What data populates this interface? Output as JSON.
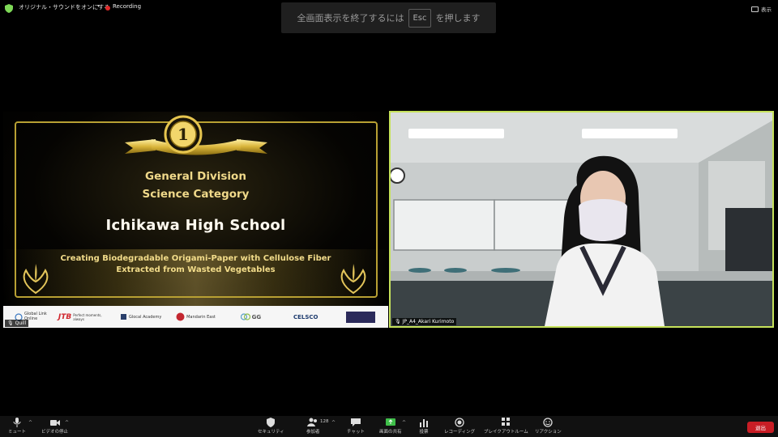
{
  "top_bar": {
    "original_sound_label": "オリジナル・サウンドをオンにする",
    "recording_label": "Recording",
    "view_label": "表示"
  },
  "fullscreen_banner": {
    "prefix": "全画面表示を終了するには",
    "key": "Esc",
    "suffix": "を押します"
  },
  "shared_screen": {
    "medal_number": "1",
    "division": "General Division",
    "category": "Science Category",
    "school": "Ichikawa High School",
    "research_line1": "Creating Biodegradable Origami-Paper with Cellulose Fiber",
    "research_line2": "Extracted from Wasted Vegetables",
    "sponsors": [
      {
        "name": "Global Link",
        "sub": "Online"
      },
      {
        "name": "JTB",
        "sub": "Perfect moments, always"
      },
      {
        "name": "Glocal Academy",
        "sub": ""
      },
      {
        "name": "Mandarin East",
        "sub": ""
      },
      {
        "name": "GG",
        "sub": ""
      },
      {
        "name": "CELSCO",
        "sub": ""
      },
      {
        "name": "",
        "sub": ""
      }
    ],
    "host_name": "Quill"
  },
  "video_tile": {
    "participant_name": "JP_A4_Akari Kurimoto"
  },
  "toolbar": {
    "mute": "ミュート",
    "stop_video": "ビデオの停止",
    "security": "セキュリティ",
    "participants": "参加者",
    "participants_count": "128",
    "chat": "チャット",
    "share_screen": "画面の共有",
    "polls": "投票",
    "recording": "レコーディング",
    "breakout_rooms": "ブレイクアウトルーム",
    "reactions": "リアクション",
    "leave": "退出"
  },
  "colors": {
    "active_speaker_border": "#c6e25b",
    "leave_button": "#c81d25",
    "recording_dot": "#e02828",
    "gold": "#f0d98a"
  }
}
